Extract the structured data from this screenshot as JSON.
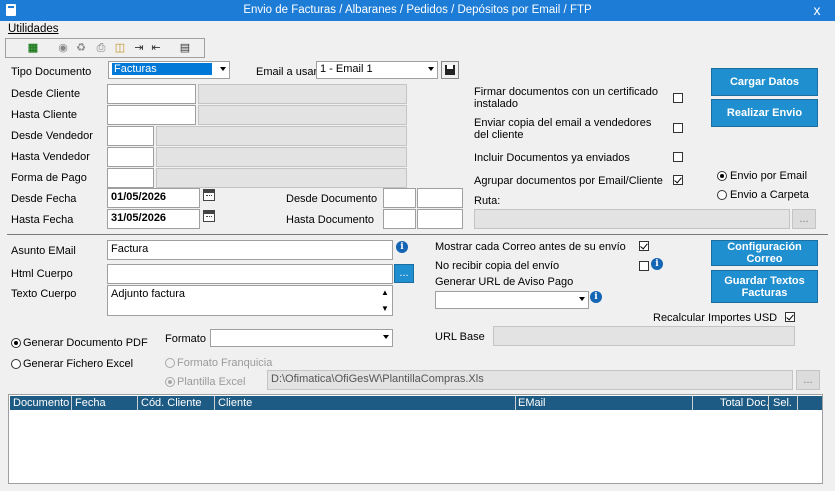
{
  "window": {
    "title": "Envio de Facturas / Albaranes / Pedidos / Depósitos por Email / FTP",
    "close": "x"
  },
  "menu": {
    "utilidades": "Utilidades"
  },
  "toolbar": {
    "icons": [
      "excel-icon",
      "binoculars-icon",
      "recycle-icon",
      "print-icon",
      "folder-open-icon",
      "import-icon",
      "export-icon",
      "report-icon"
    ]
  },
  "form": {
    "tipo_documento_label": "Tipo Documento",
    "tipo_documento_value": "Facturas",
    "email_usar_label": "Email a usar",
    "email_usar_value": "1 - Email 1",
    "desde_cliente_label": "Desde Cliente",
    "hasta_cliente_label": "Hasta Cliente",
    "desde_vendedor_label": "Desde Vendedor",
    "hasta_vendedor_label": "Hasta Vendedor",
    "forma_pago_label": "Forma de Pago",
    "desde_fecha_label": "Desde Fecha",
    "desde_fecha_value": "01/05/2026",
    "hasta_fecha_label": "Hasta Fecha",
    "hasta_fecha_value": "31/05/2026",
    "desde_documento_label": "Desde Documento",
    "hasta_documento_label": "Hasta Documento",
    "ruta_label": "Ruta:",
    "ruta_button": "..."
  },
  "options": {
    "firmar_label": "Firmar documentos con un certificado instalado",
    "firmar_checked": false,
    "copia_vendedores_label": "Enviar copia del email a vendedores del cliente",
    "copia_vendedores_checked": false,
    "incluir_enviados_label": "Incluir Documentos ya enviados",
    "incluir_enviados_checked": false,
    "agrupar_label": "Agrupar documentos por Email/Cliente",
    "agrupar_checked": true,
    "envio_email_label": "Envio por Email",
    "envio_carpeta_label": "Envio a Carpeta"
  },
  "buttons": {
    "cargar_datos": "Cargar Datos",
    "realizar_envio": "Realizar Envio",
    "config_correo": "Configuración Correo",
    "guardar_textos": "Guardar Textos Facturas"
  },
  "email": {
    "asunto_label": "Asunto EMail",
    "asunto_value": "Factura",
    "html_cuerpo_label": "Html Cuerpo",
    "html_button": "...",
    "texto_cuerpo_label": "Texto Cuerpo",
    "texto_cuerpo_value": "Adjunto factura",
    "mostrar_correo_label": "Mostrar cada Correo antes de su envío",
    "mostrar_correo_checked": true,
    "no_recibir_label": "No recibir copia del envío",
    "no_recibir_checked": false,
    "url_aviso_label": "Generar URL de  Aviso Pago",
    "recalcular_label": "Recalcular Importes USD",
    "recalcular_checked": true,
    "url_base_label": "URL Base"
  },
  "output": {
    "generar_pdf_label": "Generar Documento PDF",
    "generar_excel_label": "Generar Fichero Excel",
    "formato_label": "Formato",
    "formato_franquicia_label": "Formato Franquicia",
    "plantilla_excel_label": "Plantilla Excel",
    "plantilla_path": "D:\\Ofimatica\\OfiGesW\\PlantillaCompras.Xls",
    "plantilla_button": "..."
  },
  "grid": {
    "columns": [
      "Documento",
      "Fecha",
      "Cód. Cliente",
      "Cliente",
      "EMail",
      "Total Doc.",
      "Sel."
    ]
  },
  "colors": {
    "titlebar": "#1c7cd6",
    "button": "#1f8fcf",
    "grid_header": "#1d5a84"
  }
}
